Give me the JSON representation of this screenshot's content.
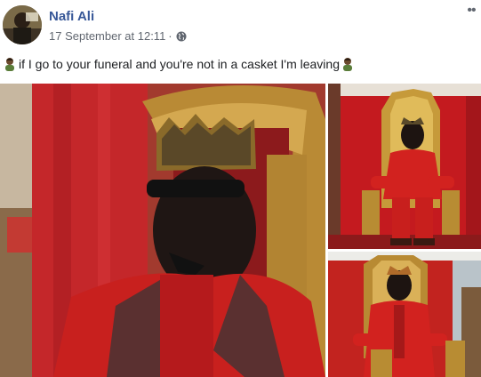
{
  "post": {
    "author": "Nafi Ali",
    "timestamp": "17 September at 12:11",
    "separator": "·",
    "audience_icon": "globe-icon",
    "more_label": "••",
    "text": "if I go to your funeral and you're not in a casket I'm leaving",
    "emoji_icon": "man-emoji-icon"
  },
  "photos": [
    {
      "name": "photo-main",
      "subject": "man in red suit and crown on throne"
    },
    {
      "name": "photo-top-right",
      "subject": "man in red suit seated on gold throne"
    },
    {
      "name": "photo-bottom-right",
      "subject": "man in red suit seated on gold throne"
    }
  ],
  "colors": {
    "link": "#385898",
    "meta": "#616770",
    "suit_red": "#c8201e",
    "curtain_red": "#c41a1f",
    "gold": "#b8902e"
  }
}
